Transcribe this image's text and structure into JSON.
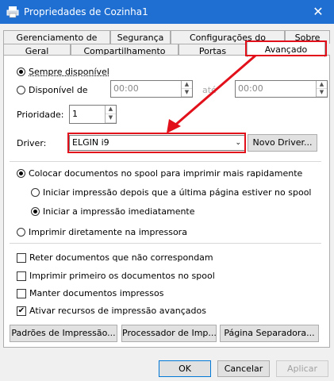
{
  "window": {
    "title": "Propriedades de Cozinha1",
    "close_glyph": "✕"
  },
  "tabs_top": [
    "Gerenciamento de Cores",
    "Segurança",
    "Configurações do Dispositivo",
    "Sobre"
  ],
  "tabs_bottom": [
    "Geral",
    "Compartilhamento",
    "Portas",
    "Avançado"
  ],
  "availability": {
    "always_label": "Sempre disponível",
    "available_from_label": "Disponível de",
    "from_time": "00:00",
    "until_label": "até",
    "to_time": "00:00"
  },
  "priority": {
    "label": "Prioridade:",
    "value": "1"
  },
  "driver": {
    "label": "Driver:",
    "selected": "ELGIN i9",
    "new_button": "Novo Driver..."
  },
  "spool": {
    "spool_label": "Colocar documentos no spool para imprimir mais rapidamente",
    "after_last_page": "Iniciar impressão depois que a última página estiver no spool",
    "immediately": "Iniciar a impressão imediatamente",
    "direct": "Imprimir diretamente na impressora"
  },
  "options": [
    {
      "label": "Reter documentos que não correspondam",
      "checked": false
    },
    {
      "label": "Imprimir primeiro os documentos no spool",
      "checked": false
    },
    {
      "label": "Manter documentos impressos",
      "checked": false
    },
    {
      "label": "Ativar recursos de impressão avançados",
      "checked": true
    }
  ],
  "bottom_buttons": [
    "Padrões de Impressão...",
    "Processador de Imp...",
    "Página Separadora..."
  ],
  "dialog_buttons": {
    "ok": "OK",
    "cancel": "Cancelar",
    "apply": "Aplicar"
  },
  "colors": {
    "titlebar": "#1f6fd3",
    "highlight": "#e2101a"
  }
}
